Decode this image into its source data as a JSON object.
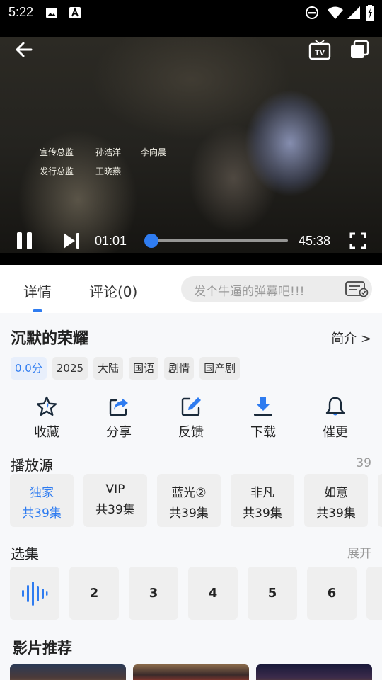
{
  "status_bar": {
    "time": "5:22"
  },
  "player": {
    "credits": {
      "row1": [
        "宣传总监",
        "孙浩洋",
        "李向晨"
      ],
      "row2": [
        "发行总监",
        "王晓燕"
      ]
    },
    "current_time": "01:01",
    "total_time": "45:38",
    "progress": 0.022,
    "icons": [
      "back-arrow-icon",
      "tv-cast-icon",
      "picture-in-picture-icon",
      "pause-icon",
      "next-episode-icon",
      "fullscreen-icon"
    ]
  },
  "tabs": {
    "details": "详情",
    "comments": "评论(0)",
    "danmaku_placeholder": "发个牛逼的弹幕吧!!!"
  },
  "show": {
    "title": "沉默的荣耀",
    "intro_link": "简介 >",
    "tags": [
      "0.0分",
      "2025",
      "大陆",
      "国语",
      "剧情",
      "国产剧"
    ]
  },
  "actions": [
    {
      "label": "收藏",
      "icon": "star-icon"
    },
    {
      "label": "分享",
      "icon": "share-icon"
    },
    {
      "label": "反馈",
      "icon": "edit-icon"
    },
    {
      "label": "下载",
      "icon": "download-icon"
    },
    {
      "label": "催更",
      "icon": "bell-icon"
    }
  ],
  "sources_section": {
    "title": "播放源",
    "count": "39",
    "items": [
      {
        "name": "独家",
        "episodes": "共39集",
        "active": true
      },
      {
        "name": "VIP",
        "episodes": "共39集"
      },
      {
        "name": "蓝光②",
        "episodes": "共39集"
      },
      {
        "name": "非凡",
        "episodes": "共39集"
      },
      {
        "name": "如意",
        "episodes": "共39集"
      }
    ]
  },
  "episodes_section": {
    "title": "选集",
    "expand": "展开",
    "items": [
      "2",
      "3",
      "4",
      "5",
      "6"
    ],
    "playing_icon": "audio-wave-icon"
  },
  "recommend": {
    "title": "影片推荐"
  },
  "colors": {
    "accent": "#2f7cf0",
    "background": "#f7f8fa",
    "chip": "#efefef"
  }
}
